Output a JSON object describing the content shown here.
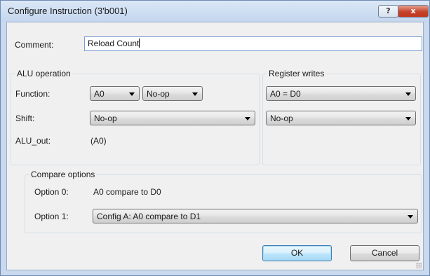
{
  "window": {
    "title": "Configure Instruction (3'b001)",
    "help_glyph": "?",
    "close_glyph": "x"
  },
  "comment": {
    "label": "Comment:",
    "value": "Reload Count"
  },
  "alu": {
    "title": "ALU operation",
    "function_label": "Function:",
    "function_source": "A0",
    "function_op": "No-op",
    "shift_label": "Shift:",
    "shift_value": "No-op",
    "out_label": "ALU_out:",
    "out_value": "(A0)"
  },
  "register_writes": {
    "title": "Register writes",
    "write_a": "A0 = D0",
    "write_b": "No-op"
  },
  "compare": {
    "title": "Compare options",
    "option0_label": "Option 0:",
    "option0_value": "A0 compare to D0",
    "option1_label": "Option 1:",
    "option1_value": "Config A: A0 compare to D1"
  },
  "buttons": {
    "ok": "OK",
    "cancel": "Cancel"
  }
}
